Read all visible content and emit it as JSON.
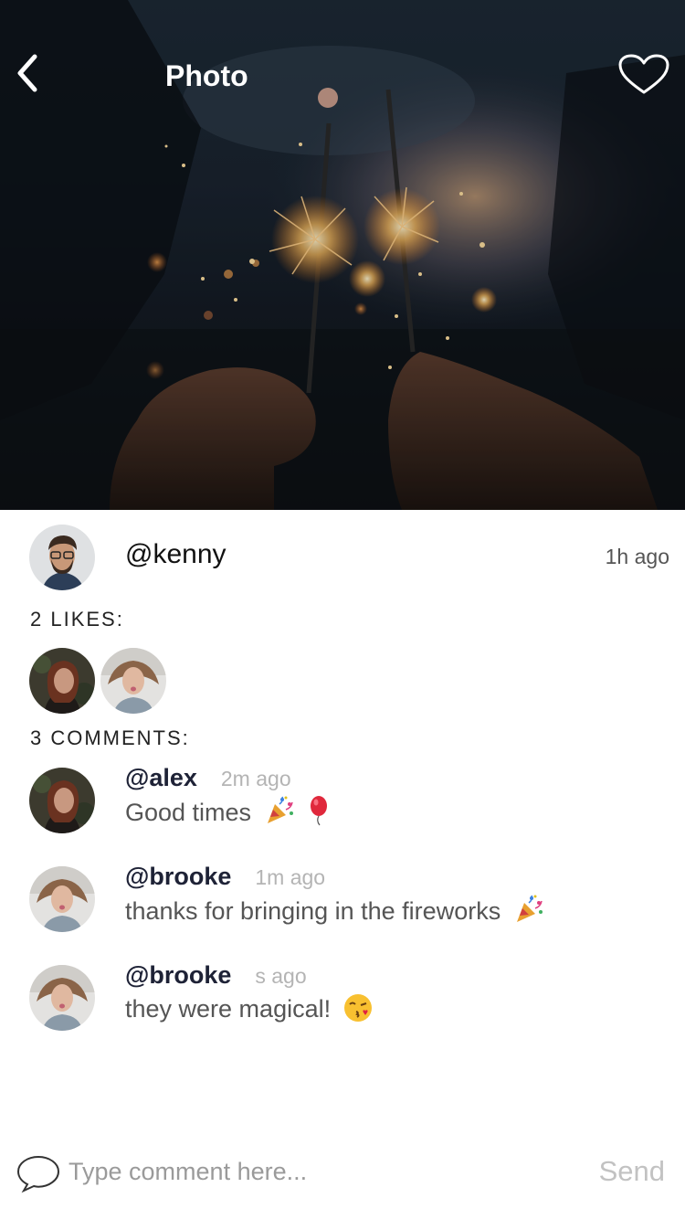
{
  "header": {
    "title": "Photo",
    "back_icon": "chevron-left-icon",
    "like_icon": "heart-outline-icon"
  },
  "post": {
    "author": "@kenny",
    "time": "1h ago"
  },
  "likes": {
    "label": "2 LIKES:",
    "users": [
      "avatar-alex",
      "avatar-brooke"
    ]
  },
  "comments": {
    "label": "3 COMMENTS:",
    "items": [
      {
        "user": "@alex",
        "time": "2m ago",
        "text": "Good times",
        "emojis": [
          "party-popper-icon",
          "balloon-icon"
        ]
      },
      {
        "user": "@brooke",
        "time": "1m ago",
        "text": "thanks for bringing in the fireworks",
        "emojis": [
          "party-popper-icon"
        ]
      },
      {
        "user": "@brooke",
        "time": "s ago",
        "text": "they were magical!",
        "emojis": [
          "kissing-face-icon"
        ]
      }
    ]
  },
  "composer": {
    "placeholder": "Type comment here...",
    "send_label": "Send",
    "icon": "speech-bubble-icon"
  },
  "colors": {
    "username": "#1e2236",
    "body_text": "#555555",
    "muted": "#b4b4b4",
    "send": "#c2c2c2"
  }
}
